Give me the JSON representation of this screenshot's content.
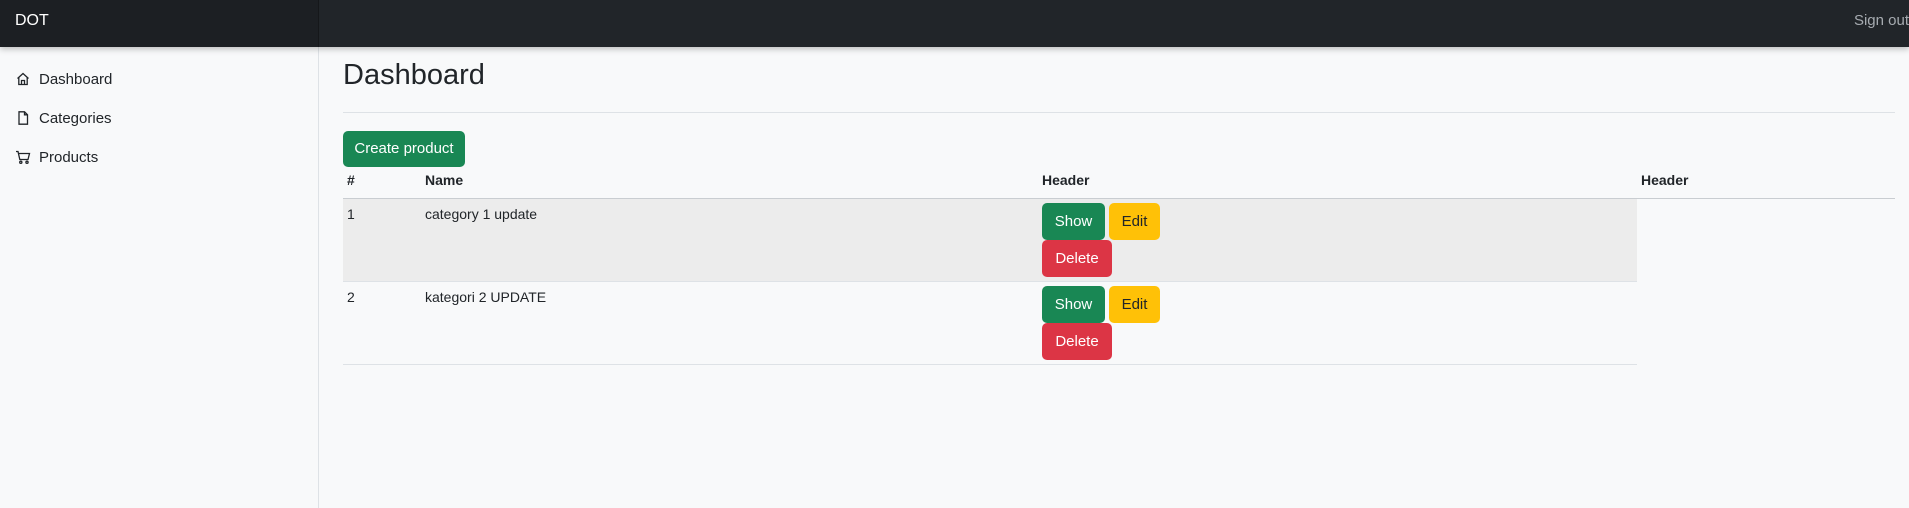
{
  "app": {
    "brand": "DOT",
    "signout_label": "Sign out"
  },
  "sidebar": {
    "items": [
      {
        "label": "Dashboard",
        "icon": "home-icon"
      },
      {
        "label": "Categories",
        "icon": "file-icon"
      },
      {
        "label": "Products",
        "icon": "cart-icon"
      }
    ]
  },
  "main": {
    "title": "Dashboard",
    "create_label": "Create product",
    "table": {
      "headers": [
        "#",
        "Name",
        "Header",
        "Header"
      ],
      "rows": [
        {
          "id": "1",
          "name": "category 1 update"
        },
        {
          "id": "2",
          "name": "kategori 2 UPDATE"
        }
      ],
      "actions": {
        "show": "Show",
        "edit": "Edit",
        "delete": "Delete"
      }
    }
  },
  "colors": {
    "success": "#198754",
    "warning": "#ffc107",
    "danger": "#dc3545",
    "topbar": "#212529"
  }
}
